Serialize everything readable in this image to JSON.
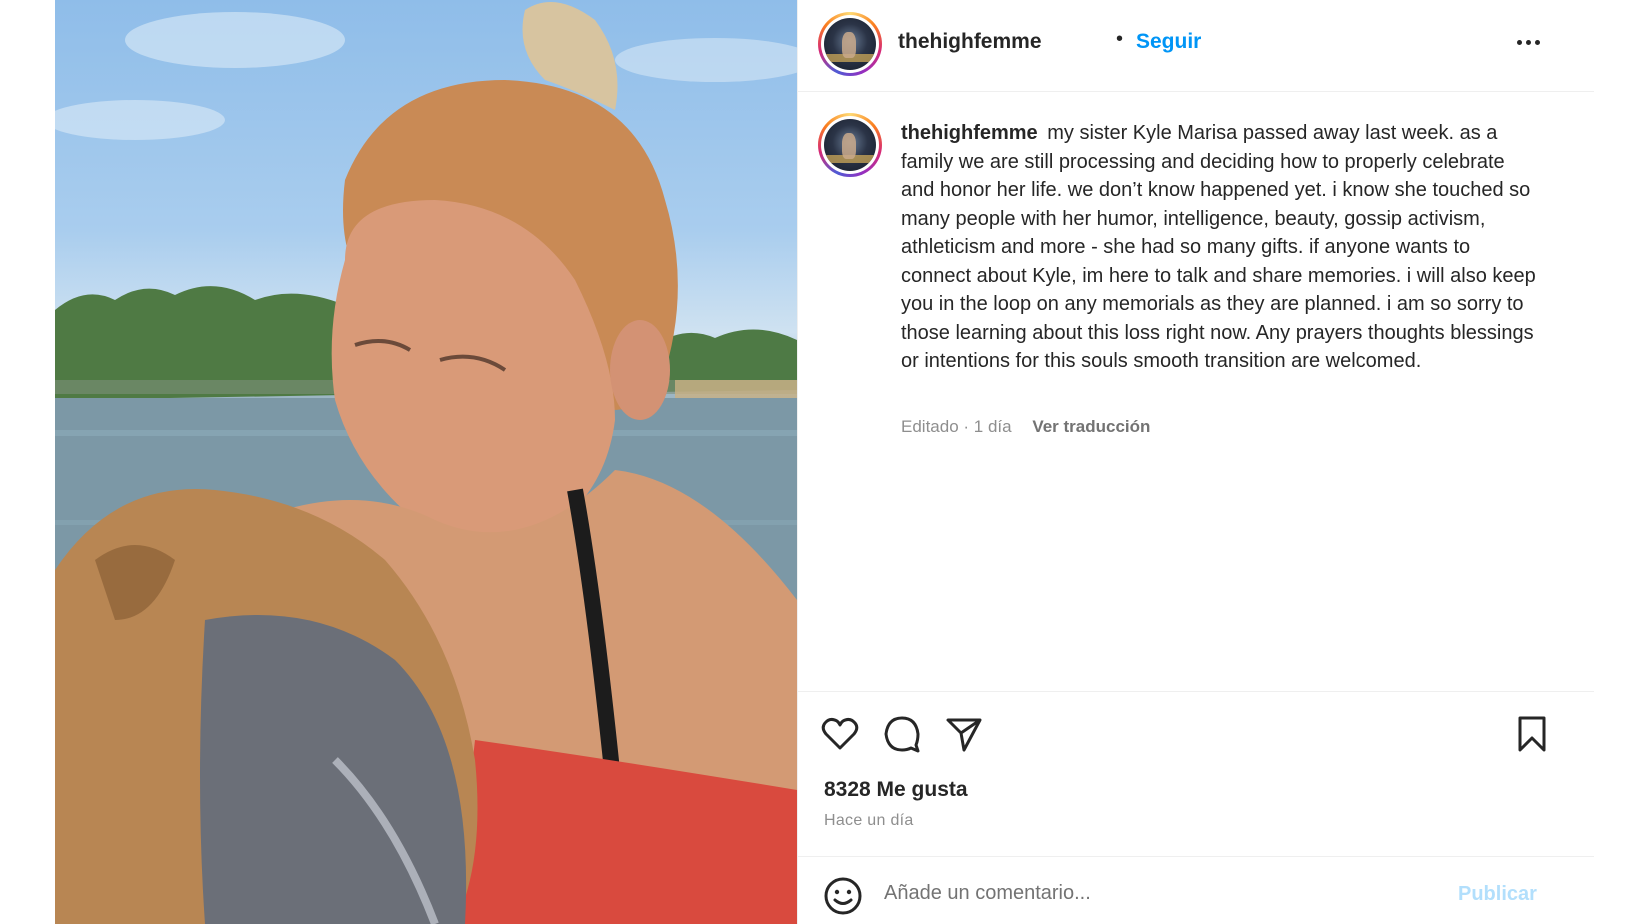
{
  "header": {
    "username": "thehighfemme",
    "separator": "•",
    "follow_label": "Seguir",
    "more_icon": "more-horizontal-icon"
  },
  "caption": {
    "username": "thehighfemme",
    "text": "my sister Kyle Marisa passed away last week. as a family we are still processing and deciding how to properly celebrate and honor her life. we don’t know happened yet. i know she touched so many people with her humor, intelligence, beauty, gossip activism, athleticism and more - she had so many gifts. if anyone wants to connect about Kyle, im here to talk and share memories. i will also keep you in the loop on any memorials as they are planned. i am so sorry to those learning about this loss right now. Any prayers thoughts blessings or intentions for this souls smooth transition are welcomed.",
    "meta": "Editado · 1 día",
    "translate_label": "Ver traducción"
  },
  "actions": {
    "icons": [
      "heart-icon",
      "comment-icon",
      "share-icon",
      "bookmark-icon"
    ],
    "likes": "8328 Me gusta",
    "time_ago": "Hace un día"
  },
  "comment": {
    "emoji_icon": "emoji-icon",
    "placeholder": "Añade un comentario...",
    "publish_label": "Publicar"
  },
  "colors": {
    "accent": "#0095f6",
    "publish_disabled": "#b2dffc",
    "muted": "#8e8e8e",
    "text": "#262626"
  }
}
